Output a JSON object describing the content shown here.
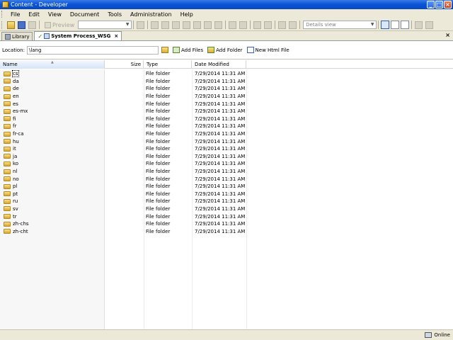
{
  "window": {
    "title": "Content - Developer"
  },
  "menu": [
    "File",
    "Edit",
    "View",
    "Document",
    "Tools",
    "Administration",
    "Help"
  ],
  "toolbar": {
    "preview_label": "Preview",
    "preview_combo_value": "",
    "view_combo_value": "Details view"
  },
  "tabs": [
    {
      "label": "Library",
      "active": false
    },
    {
      "label": "System Process_WSG",
      "active": true
    }
  ],
  "location": {
    "label": "Location:",
    "value": "\\lang",
    "actions": {
      "add_files": "Add Files",
      "add_folder": "Add Folder",
      "new_html_file": "New Html File"
    }
  },
  "columns": {
    "name": "Name",
    "size": "Size",
    "type": "Type",
    "date": "Date Modified"
  },
  "files": [
    {
      "name": "cs",
      "type": "File folder",
      "date": "7/29/2014 11:31 AM"
    },
    {
      "name": "da",
      "type": "File folder",
      "date": "7/29/2014 11:31 AM"
    },
    {
      "name": "de",
      "type": "File folder",
      "date": "7/29/2014 11:31 AM"
    },
    {
      "name": "en",
      "type": "File folder",
      "date": "7/29/2014 11:31 AM"
    },
    {
      "name": "es",
      "type": "File folder",
      "date": "7/29/2014 11:31 AM"
    },
    {
      "name": "es-mx",
      "type": "File folder",
      "date": "7/29/2014 11:31 AM"
    },
    {
      "name": "fi",
      "type": "File folder",
      "date": "7/29/2014 11:31 AM"
    },
    {
      "name": "fr",
      "type": "File folder",
      "date": "7/29/2014 11:31 AM"
    },
    {
      "name": "fr-ca",
      "type": "File folder",
      "date": "7/29/2014 11:31 AM"
    },
    {
      "name": "hu",
      "type": "File folder",
      "date": "7/29/2014 11:31 AM"
    },
    {
      "name": "it",
      "type": "File folder",
      "date": "7/29/2014 11:31 AM"
    },
    {
      "name": "ja",
      "type": "File folder",
      "date": "7/29/2014 11:31 AM"
    },
    {
      "name": "ko",
      "type": "File folder",
      "date": "7/29/2014 11:31 AM"
    },
    {
      "name": "nl",
      "type": "File folder",
      "date": "7/29/2014 11:31 AM"
    },
    {
      "name": "no",
      "type": "File folder",
      "date": "7/29/2014 11:31 AM"
    },
    {
      "name": "pl",
      "type": "File folder",
      "date": "7/29/2014 11:31 AM"
    },
    {
      "name": "pt",
      "type": "File folder",
      "date": "7/29/2014 11:31 AM"
    },
    {
      "name": "ru",
      "type": "File folder",
      "date": "7/29/2014 11:31 AM"
    },
    {
      "name": "sv",
      "type": "File folder",
      "date": "7/29/2014 11:31 AM"
    },
    {
      "name": "tr",
      "type": "File folder",
      "date": "7/29/2014 11:31 AM"
    },
    {
      "name": "zh-chs",
      "type": "File folder",
      "date": "7/29/2014 11:31 AM"
    },
    {
      "name": "zh-cht",
      "type": "File folder",
      "date": "7/29/2014 11:31 AM"
    }
  ],
  "status": {
    "connection": "Online"
  }
}
